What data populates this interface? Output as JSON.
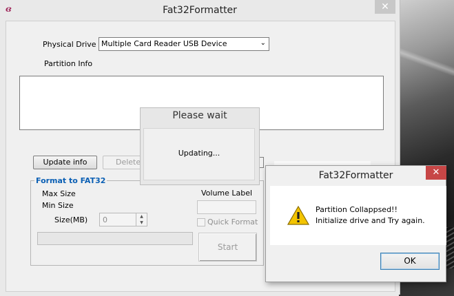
{
  "main_window": {
    "title": "Fat32Formatter",
    "app_icon_glyph": "ɞ",
    "close_glyph": "✕",
    "physical_drive_label": "Physical Drive",
    "physical_drive_value": "Multiple Card  Reader USB Device",
    "dropdown_arrow": "⌄",
    "partition_info_label": "Partition Info",
    "update_info_button": "Update info",
    "delete_button": "Delete",
    "format_group": {
      "legend": "Format to FAT32",
      "max_size_label": "Max Size",
      "min_size_label": "Min Size",
      "size_mb_label": "Size(MB)",
      "size_mb_value": "0",
      "volume_label_label": "Volume Label",
      "quick_format_label": "Quick Format",
      "start_button": "Start"
    }
  },
  "wait_dialog": {
    "title": "Please wait",
    "message": "Updating..."
  },
  "error_dialog": {
    "title": "Fat32Formatter",
    "close_glyph": "✕",
    "line1": "Partition Collappsed!!",
    "line2": "Initialize drive and Try again.",
    "ok_button": "OK",
    "icon": "warning-icon"
  },
  "colors": {
    "accent_blue": "#0a5fb4",
    "close_red": "#c74646",
    "warning_yellow": "#f3c400"
  }
}
